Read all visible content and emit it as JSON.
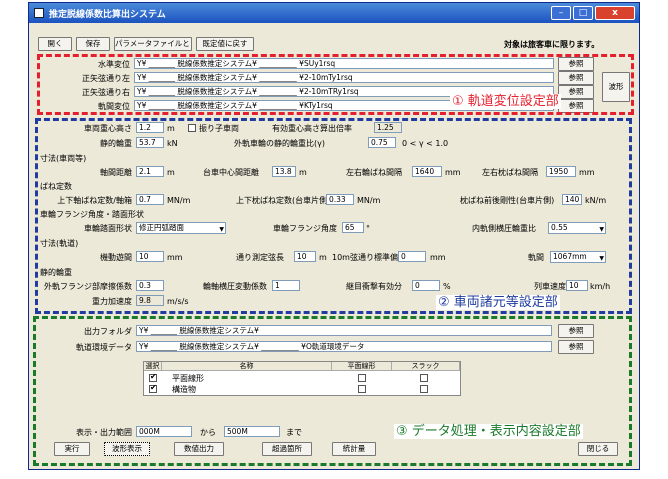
{
  "window": {
    "title": "推定脱線係数比算出システム",
    "close_glyph": "x",
    "min_glyph": "–",
    "max_glyph": "□"
  },
  "toolbar": {
    "open": "開く",
    "save": "保存",
    "save_pattern": "パラメータファイルとして保存",
    "reset": "既定値に戻す",
    "notice": "対象は旅客車に限ります。"
  },
  "track": {
    "rows": [
      {
        "label": "水準変位",
        "value": "Y¥  _______ 脱線係数推定システム¥ __________ ¥SUy1rsq",
        "btn": "参照"
      },
      {
        "label": "正矢弦通り左",
        "value": "Y¥  _______ 脱線係数推定システム¥ __________ ¥2-10mTy1rsq",
        "btn": "参照"
      },
      {
        "label": "正矢弦通り右",
        "value": "Y¥  _______ 脱線係数推定システム¥ __________ ¥2-10mTRy1rsq",
        "btn": "参照"
      },
      {
        "label": "軌間変位",
        "value": "Y¥  _______ 脱線係数推定システム¥ __________ ¥KTy1rsq",
        "btn": "参照"
      }
    ],
    "wave_btn": "波形"
  },
  "vehicle": {
    "cg_height_label": "車両重心高さ",
    "cg_height": "1.2",
    "cg_height_unit": "m",
    "pendulum_label": "振り子車両",
    "eff_cg_label": "有効重心高さ算出倍率",
    "eff_cg": "1.25",
    "static_load_label": "静的輪重",
    "static_load": "53.7",
    "static_load_unit": "kN",
    "imbalance_label": "外軌車輪の静的輪重比(γ)",
    "imbalance": "0.75",
    "imbalance_range": "0 < γ < 1.0",
    "dim_header": "寸法(車両等)",
    "wheelbase_label": "軸間距離",
    "wheelbase": "2.1",
    "wheelbase_unit": "m",
    "bogie_label": "台車中心間距離",
    "bogie": "13.8",
    "bogie_unit": "m",
    "wheel_gauge_label": "左右輪ばね間隔",
    "wheel_gauge": "1640",
    "wheel_gauge_unit": "mm",
    "spring_gauge_label": "左右枕ばね間隔",
    "spring_gauge": "1950",
    "spring_gauge_unit": "mm",
    "spring_header": "ばね定数",
    "axle_spring_label": "上下軸ばね定数/軸箱",
    "axle_spring": "0.7",
    "axle_spring_unit": "MN/m",
    "bolster_spring_label": "上下枕ばね定数(台車片側)",
    "bolster_spring": "0.33",
    "bolster_spring_unit": "MN/m",
    "bolster_rigidity_label": "枕ばね前後剛性(台車片側)",
    "bolster_rigidity": "140",
    "bolster_rigidity_unit": "kN/m",
    "flange_header": "車輪フランジ角度・踏面形状",
    "tread_label": "車輪踏面形状",
    "tread": "修正円弧踏面",
    "flange_angle_label": "車輪フランジ角度",
    "flange_angle": "65",
    "flange_angle_unit": "°",
    "inner_label": "内軌側横圧輪重比",
    "inner": "0.55",
    "track_dim_header": "寸法(軌道)",
    "slack_label": "機動遊間",
    "slack": "10",
    "slack_unit": "mm",
    "chord_label": "通り測定弦長",
    "chord": "10",
    "chord_unit": "m",
    "std_dev_label": "10m弦通り標準偏差",
    "std_dev": "0",
    "std_dev_unit": "mm",
    "gauge_label": "軌間",
    "gauge": "1067mm",
    "dyn_header": "静的輪重",
    "ext_flange_label": "外軌フランジ部摩擦係数",
    "ext_flange": "0.3",
    "lat_coef_label": "輪軸横圧変動係数",
    "lat_coef": "1",
    "impact_label": "継目衝撃有効分",
    "impact": "0",
    "impact_unit": "%",
    "speed_label": "列車速度",
    "speed": "10",
    "speed_unit": "km/h",
    "accel_label": "重力加速度",
    "accel": "9.8",
    "accel_unit": "m/s/s"
  },
  "output": {
    "folder_label": "出力フォルダ",
    "folder": "Y¥  _______ 脱線係数推定システム¥",
    "folder_btn": "参照",
    "env_label": "軌道環境データ",
    "env": "Y¥  _______ 脱線係数推定システム¥ __________ ¥O軌道環境データ",
    "env_btn": "参照",
    "table": {
      "headers": [
        "選択",
        "名称",
        "平面線形",
        "スラック"
      ],
      "rows": [
        {
          "name": "平面線形"
        },
        {
          "name": "構造物"
        }
      ]
    },
    "range_label": "表示・出力範囲",
    "range_from": "000M",
    "range_from_label": "から",
    "range_to": "500M",
    "range_to_label": "まで"
  },
  "bottom": {
    "run": "実行",
    "wave": "波形表示",
    "numeric": "数値出力",
    "over": "超過箇所",
    "stats": "統計量",
    "close": "閉じる"
  },
  "annotations": {
    "r1": "① 軌道変位設定部",
    "r2": "② 車両諸元等設定部",
    "r3": "③ データ処理・表示内容設定部"
  }
}
